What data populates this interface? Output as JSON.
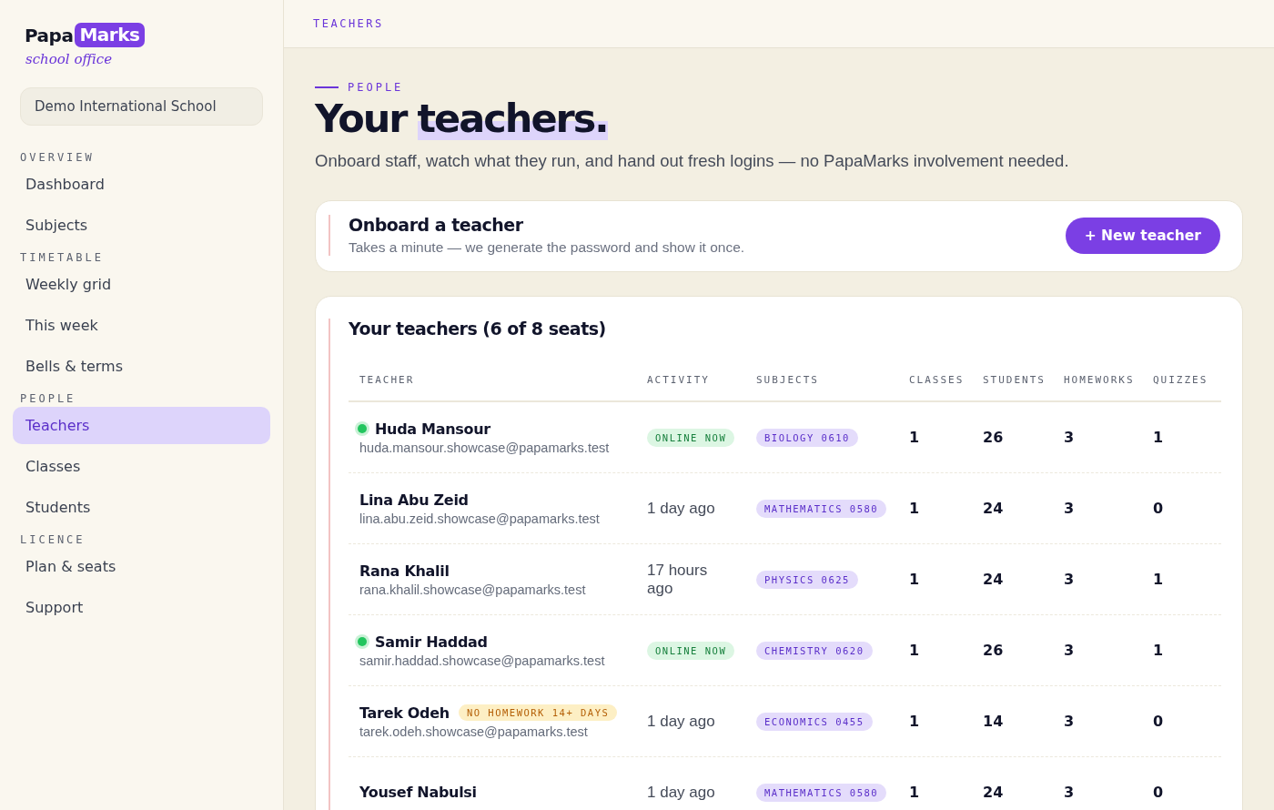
{
  "brand": {
    "name_lead": "Papa",
    "name_badge": "Marks",
    "tagline": "school office"
  },
  "school": "Demo International School",
  "nav": [
    {
      "title": "OVERVIEW",
      "items": [
        {
          "label": "Dashboard",
          "selected": false
        },
        {
          "label": "Subjects",
          "selected": false
        }
      ]
    },
    {
      "title": "TIMETABLE",
      "items": [
        {
          "label": "Weekly grid",
          "selected": false
        },
        {
          "label": "This week",
          "selected": false
        },
        {
          "label": "Bells & terms",
          "selected": false
        }
      ]
    },
    {
      "title": "PEOPLE",
      "items": [
        {
          "label": "Teachers",
          "selected": true
        },
        {
          "label": "Classes",
          "selected": false
        },
        {
          "label": "Students",
          "selected": false
        }
      ]
    },
    {
      "title": "LICENCE",
      "items": [
        {
          "label": "Plan & seats",
          "selected": false
        },
        {
          "label": "Support",
          "selected": false
        }
      ]
    }
  ],
  "topbar": {
    "crumb": "TEACHERS"
  },
  "page": {
    "eyebrow": "PEOPLE",
    "title_lead": "Your",
    "title_highlight": "teachers.",
    "subtitle": "Onboard staff, watch what they run, and hand out fresh logins — no PapaMarks involvement needed."
  },
  "onboard": {
    "title": "Onboard a teacher",
    "text": "Takes a minute — we generate the password and show it once.",
    "button": "+ New teacher"
  },
  "table": {
    "title": "Your teachers (6 of 8 seats)",
    "columns": [
      "TEACHER",
      "ACTIVITY",
      "SUBJECTS",
      "CLASSES",
      "STUDENTS",
      "HOMEWORKS",
      "QUIZZES"
    ],
    "rows": [
      {
        "name": "Huda Mansour",
        "online": true,
        "email": "huda.mansour.showcase@papamarks.test",
        "activity": {
          "kind": "badge",
          "text": "ONLINE NOW"
        },
        "subject": "BIOLOGY 0610",
        "classes": "1",
        "students": "26",
        "homeworks": "3",
        "quizzes": "1"
      },
      {
        "name": "Lina Abu Zeid",
        "online": false,
        "email": "lina.abu.zeid.showcase@papamarks.test",
        "activity": {
          "kind": "text",
          "text": "1 day ago"
        },
        "subject": "MATHEMATICS 0580",
        "classes": "1",
        "students": "24",
        "homeworks": "3",
        "quizzes": "0"
      },
      {
        "name": "Rana Khalil",
        "online": false,
        "email": "rana.khalil.showcase@papamarks.test",
        "activity": {
          "kind": "text",
          "text": "17 hours ago"
        },
        "subject": "PHYSICS 0625",
        "classes": "1",
        "students": "24",
        "homeworks": "3",
        "quizzes": "1"
      },
      {
        "name": "Samir Haddad",
        "online": true,
        "email": "samir.haddad.showcase@papamarks.test",
        "activity": {
          "kind": "badge",
          "text": "ONLINE NOW"
        },
        "subject": "CHEMISTRY 0620",
        "classes": "1",
        "students": "26",
        "homeworks": "3",
        "quizzes": "1"
      },
      {
        "name": "Tarek Odeh",
        "online": false,
        "warning": "NO HOMEWORK 14+ DAYS",
        "email": "tarek.odeh.showcase@papamarks.test",
        "activity": {
          "kind": "text",
          "text": "1 day ago"
        },
        "subject": "ECONOMICS 0455",
        "classes": "1",
        "students": "14",
        "homeworks": "3",
        "quizzes": "0"
      },
      {
        "name": "Yousef Nabulsi",
        "online": false,
        "activity": {
          "kind": "text",
          "text": "1 day ago"
        },
        "subject": "MATHEMATICS 0580",
        "classes": "1",
        "students": "24",
        "homeworks": "3",
        "quizzes": "0"
      }
    ]
  }
}
